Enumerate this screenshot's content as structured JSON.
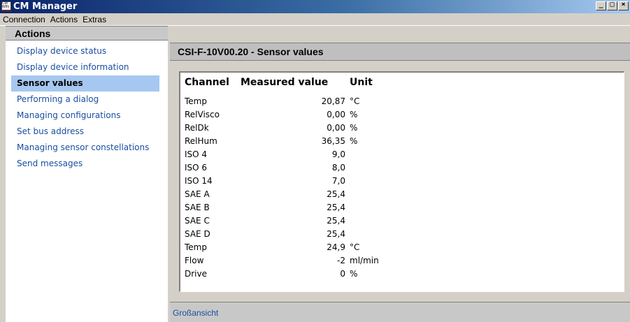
{
  "window": {
    "title": "CM Manager",
    "icon_text": "CM WIN",
    "buttons": {
      "minimize": "_",
      "maximize": "□",
      "close": "×"
    }
  },
  "menu": [
    "Connection",
    "Actions",
    "Extras"
  ],
  "sidebar": {
    "title": "Actions",
    "items": [
      {
        "label": "Display device status"
      },
      {
        "label": "Display device information"
      },
      {
        "label": "Sensor values",
        "active": true
      },
      {
        "label": "Performing a dialog"
      },
      {
        "label": "Managing configurations"
      },
      {
        "label": "Set bus address"
      },
      {
        "label": "Managing sensor constellations"
      },
      {
        "label": "Send messages"
      }
    ]
  },
  "main": {
    "title": "CSI-F-10V00.20 - Sensor values",
    "table": {
      "headers": [
        "Channel",
        "Measured value",
        "Unit"
      ],
      "rows": [
        {
          "channel": "Temp",
          "value": "20,87",
          "unit": "°C"
        },
        {
          "channel": "RelVisco",
          "value": "0,00",
          "unit": "%"
        },
        {
          "channel": "RelDk",
          "value": "0,00",
          "unit": "%"
        },
        {
          "channel": "RelHum",
          "value": "36,35",
          "unit": "%"
        },
        {
          "channel": "ISO 4",
          "value": "9,0",
          "unit": ""
        },
        {
          "channel": "ISO 6",
          "value": "8,0",
          "unit": ""
        },
        {
          "channel": "ISO 14",
          "value": "7,0",
          "unit": ""
        },
        {
          "channel": "SAE A",
          "value": "25,4",
          "unit": ""
        },
        {
          "channel": "SAE B",
          "value": "25,4",
          "unit": ""
        },
        {
          "channel": "SAE C",
          "value": "25,4",
          "unit": ""
        },
        {
          "channel": "SAE D",
          "value": "25,4",
          "unit": ""
        },
        {
          "channel": "Temp",
          "value": "24,9",
          "unit": "°C"
        },
        {
          "channel": "Flow",
          "value": "-2",
          "unit": "ml/min"
        },
        {
          "channel": "Drive",
          "value": "0",
          "unit": "%"
        }
      ]
    }
  },
  "footer": {
    "link": "Großansicht"
  },
  "colors": {
    "nav_link": "#1a4ea0",
    "active_bg": "#a6c8f0"
  }
}
